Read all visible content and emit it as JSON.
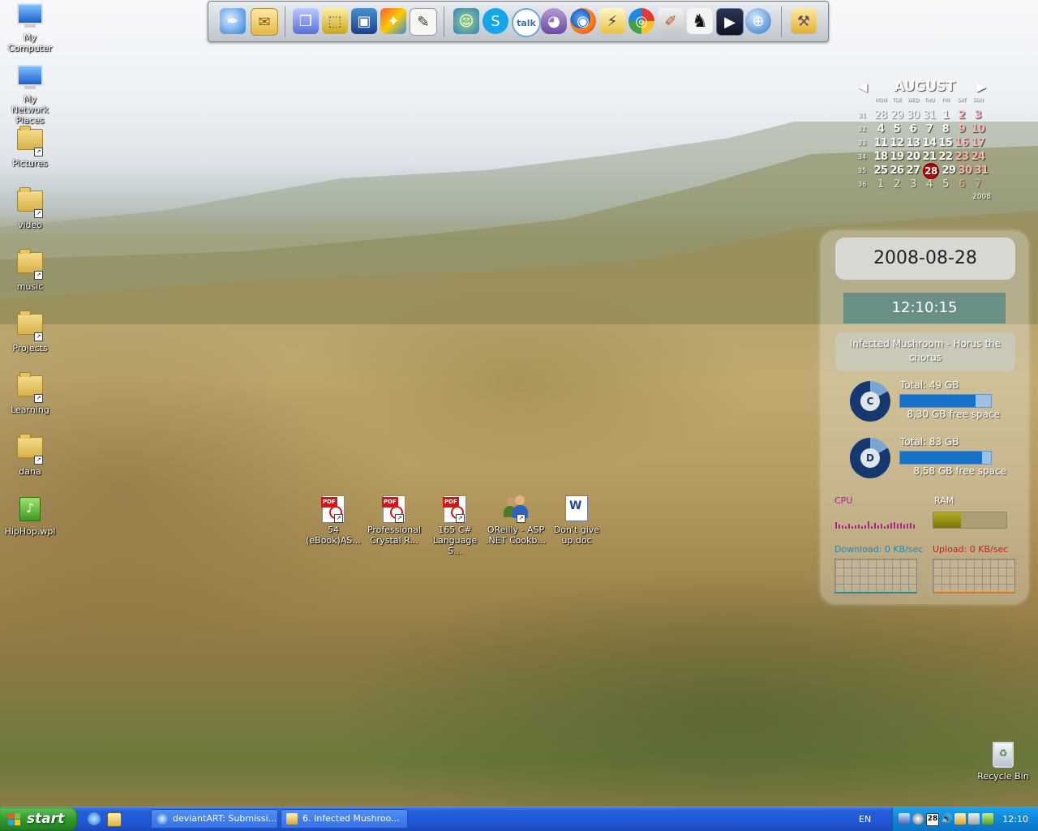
{
  "desktop": {
    "icons": [
      {
        "label": "My Computer"
      },
      {
        "label": "My Network Places"
      },
      {
        "label": "Pictures"
      },
      {
        "label": "video"
      },
      {
        "label": "music"
      },
      {
        "label": "Projects"
      },
      {
        "label": "Learning"
      },
      {
        "label": "dana"
      },
      {
        "label": "HipHop.wpl"
      }
    ],
    "files": [
      {
        "line1": "54",
        "line2": "(eBook)AS..."
      },
      {
        "line1": "Professional",
        "line2": "Crystal R..."
      },
      {
        "line1": "165 C#",
        "line2": "Language S..."
      },
      {
        "line1": "OReilly - ASP",
        "line2": ".NET Cookb..."
      },
      {
        "line1": "Don't give",
        "line2": "up.doc"
      }
    ],
    "recycle_bin": "Recycle Bin"
  },
  "dock": {
    "items": [
      "quill-icon",
      "outlook-icon",
      "cube-icon",
      "selection-icon",
      "monitor-icon",
      "puzzle-icon",
      "notepad-icon",
      "messenger-icon",
      "skype-icon",
      "gtalk-icon",
      "pidgin-icon",
      "firefox-icon",
      "winamp-icon",
      "picasa-icon",
      "paint-icon",
      "horse-icon",
      "media-player-icon",
      "globe-icon",
      "tools-icon"
    ]
  },
  "calendar": {
    "month": "AUGUST",
    "year": "2008",
    "dows": [
      "MON",
      "TUE",
      "WED",
      "THU",
      "FRI",
      "SAT",
      "SUN"
    ],
    "weeks": [
      {
        "num": "31",
        "days": [
          "28",
          "29",
          "30",
          "31",
          "1",
          "2",
          "3"
        ]
      },
      {
        "num": "32",
        "days": [
          "4",
          "5",
          "6",
          "7",
          "8",
          "9",
          "10"
        ]
      },
      {
        "num": "33",
        "days": [
          "11",
          "12",
          "13",
          "14",
          "15",
          "16",
          "17"
        ]
      },
      {
        "num": "34",
        "days": [
          "18",
          "19",
          "20",
          "21",
          "22",
          "23",
          "24"
        ]
      },
      {
        "num": "35",
        "days": [
          "25",
          "26",
          "27",
          "28",
          "29",
          "30",
          "31"
        ]
      },
      {
        "num": "36",
        "days": [
          "1",
          "2",
          "3",
          "4",
          "5",
          "6",
          "7"
        ]
      }
    ],
    "today": "28"
  },
  "panel": {
    "date": "2008-08-28",
    "time": "12:10:15",
    "track_line1": "Infected Mushroom - Horus the",
    "track_line2": "chorus",
    "drives": [
      {
        "letter": "C",
        "total": "Total: 49 GB",
        "free": "8,30 GB free space",
        "used_fraction": 0.83
      },
      {
        "letter": "D",
        "total": "Total: 83 GB",
        "free": "8,58 GB free space",
        "used_fraction": 0.9
      }
    ],
    "cpu_label": "CPU",
    "ram_label": "RAM",
    "ram_fraction": 0.38,
    "download_label": "Download: 0 KB/sec",
    "upload_label": "Upload: 0 KB/sec"
  },
  "taskbar": {
    "start_label": "start",
    "tasks": [
      {
        "label": "deviantART: Submissi..."
      },
      {
        "label": "6. Infected Mushroo..."
      }
    ],
    "language": "EN",
    "clock": "12:10",
    "tray_date_badge": "28"
  },
  "colors": {
    "taskbar_blue": "#245edb",
    "start_green": "#2f9a2c",
    "tray_blue": "#0f86d8",
    "cpu_magenta": "#b0208a",
    "download_blue": "#208ab8",
    "upload_red": "#c8202a",
    "drive_blue": "#1473c8"
  }
}
